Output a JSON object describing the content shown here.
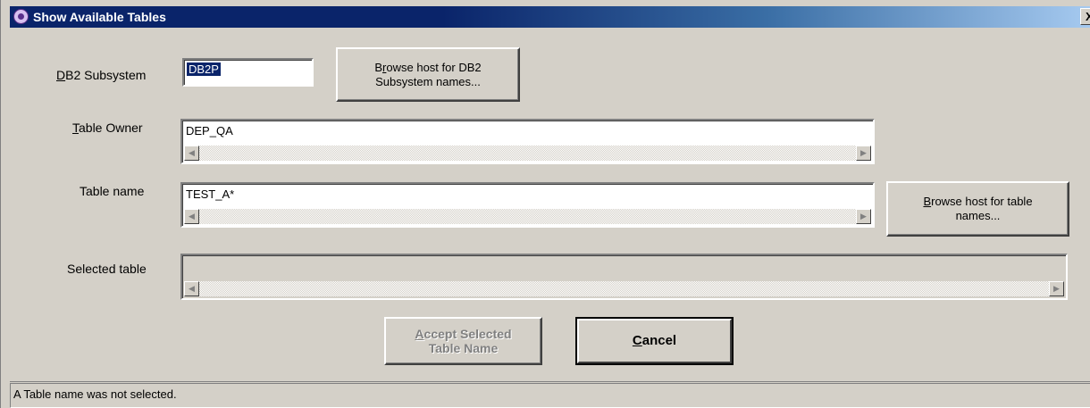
{
  "window": {
    "title": "Show Available Tables",
    "close_glyph": "X",
    "app_icon": "db2-icon"
  },
  "db2_subsystem": {
    "label_accel": "D",
    "label_rest": "B2 Subsystem",
    "value": "DB2P"
  },
  "browse_subsystem_button": {
    "line1_pre": "B",
    "line1_accel": "r",
    "line1_post": "owse host for DB2",
    "line2": "Subsystem names..."
  },
  "table_owner": {
    "label_accel": "T",
    "label_rest": "able Owner",
    "value": "DEP_QA"
  },
  "table_name": {
    "label": "Table name",
    "value": "TEST_A*"
  },
  "browse_table_button": {
    "line1_accel": "B",
    "line1_rest": "rowse host for table",
    "line2": "names..."
  },
  "selected_table": {
    "label": "Selected table",
    "value": ""
  },
  "accept_button": {
    "line1_accel": "A",
    "line1_rest": "ccept Selected",
    "line2": "Table Name"
  },
  "cancel_button": {
    "label_accel": "C",
    "label_rest": "ancel"
  },
  "status": {
    "text": "A Table name was not selected."
  }
}
